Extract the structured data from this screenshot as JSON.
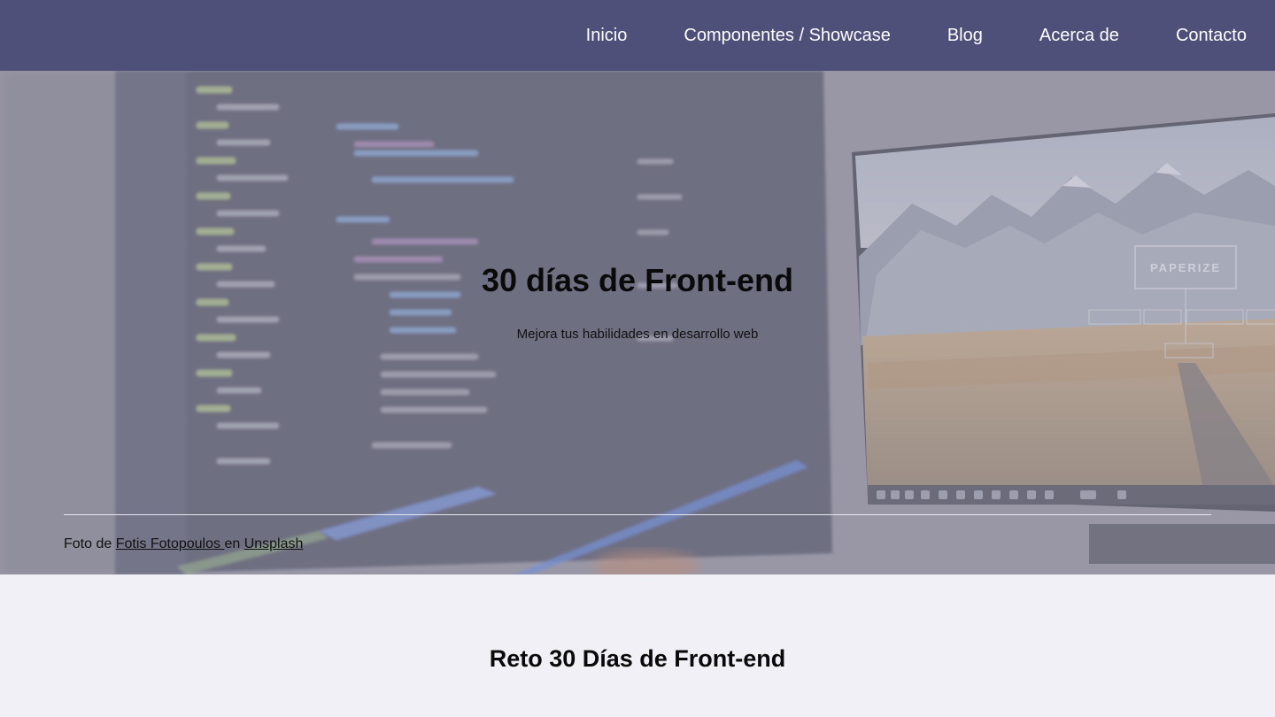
{
  "nav": {
    "items": [
      {
        "label": "Inicio"
      },
      {
        "label": "Componentes / Showcase"
      },
      {
        "label": "Blog"
      },
      {
        "label": "Acerca de"
      },
      {
        "label": "Contacto"
      }
    ]
  },
  "hero": {
    "title": "30 días de Front-end",
    "subtitle": "Mejora tus habilidades en desarrollo web",
    "photo_text": "PAPERIZE",
    "credit": {
      "prefix": "Foto de ",
      "author": "Fotis Fotopoulos ",
      "middle": "en ",
      "site": "Unsplash"
    }
  },
  "section": {
    "title": "Reto 30 Días de Front-end"
  },
  "colors": {
    "nav_bg": "#4e5079",
    "page_bg": "#f2f0f7",
    "overlay": "#a9a7b8"
  }
}
